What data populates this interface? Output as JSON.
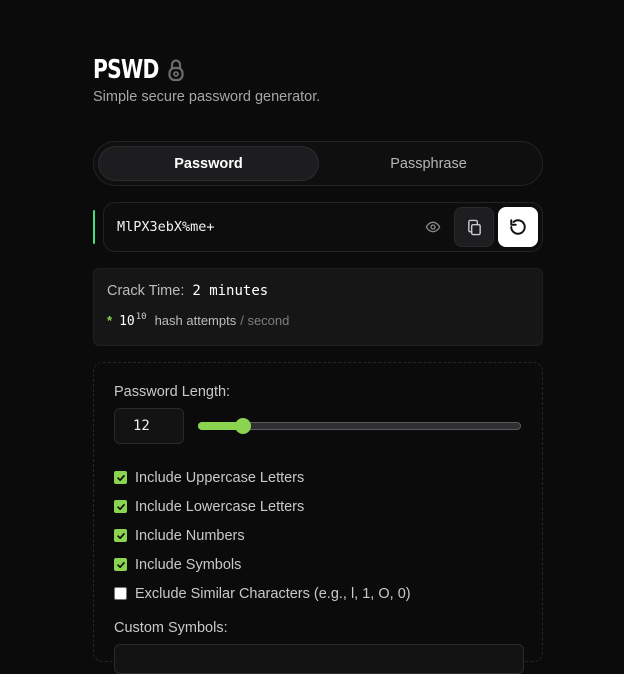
{
  "header": {
    "title": "PSWD",
    "tagline": "Simple secure password generator.",
    "icon": "lock-icon"
  },
  "mode_tabs": [
    {
      "label": "Password",
      "active": true
    },
    {
      "label": "Passphrase",
      "active": false
    }
  ],
  "password": {
    "value": "MlPX3ebX%me+",
    "strength_color": "#4ade80",
    "actions": {
      "toggle_visibility_icon": "eye-icon",
      "copy_icon": "copy-icon",
      "regenerate_icon": "refresh-icon"
    }
  },
  "crack_time": {
    "label": "Crack Time:",
    "value": "2 minutes",
    "rate_bullet": "*",
    "rate_base": "10",
    "rate_exponent": "10",
    "rate_text": "hash attempts",
    "rate_unit": "/ second"
  },
  "options": {
    "length_label": "Password Length:",
    "length_value": "12",
    "length_fraction": 0.12,
    "checkboxes": [
      {
        "label": "Include Uppercase Letters",
        "checked": true
      },
      {
        "label": "Include Lowercase Letters",
        "checked": true
      },
      {
        "label": "Include Numbers",
        "checked": true
      },
      {
        "label": "Include Symbols",
        "checked": true
      },
      {
        "label": "Exclude Similar Characters (e.g., l, 1, O, 0)",
        "checked": false
      }
    ],
    "custom_symbols_label": "Custom Symbols:",
    "custom_symbols_value": ""
  },
  "colors": {
    "accent": "#8bd450",
    "background": "#0b0b0c"
  }
}
